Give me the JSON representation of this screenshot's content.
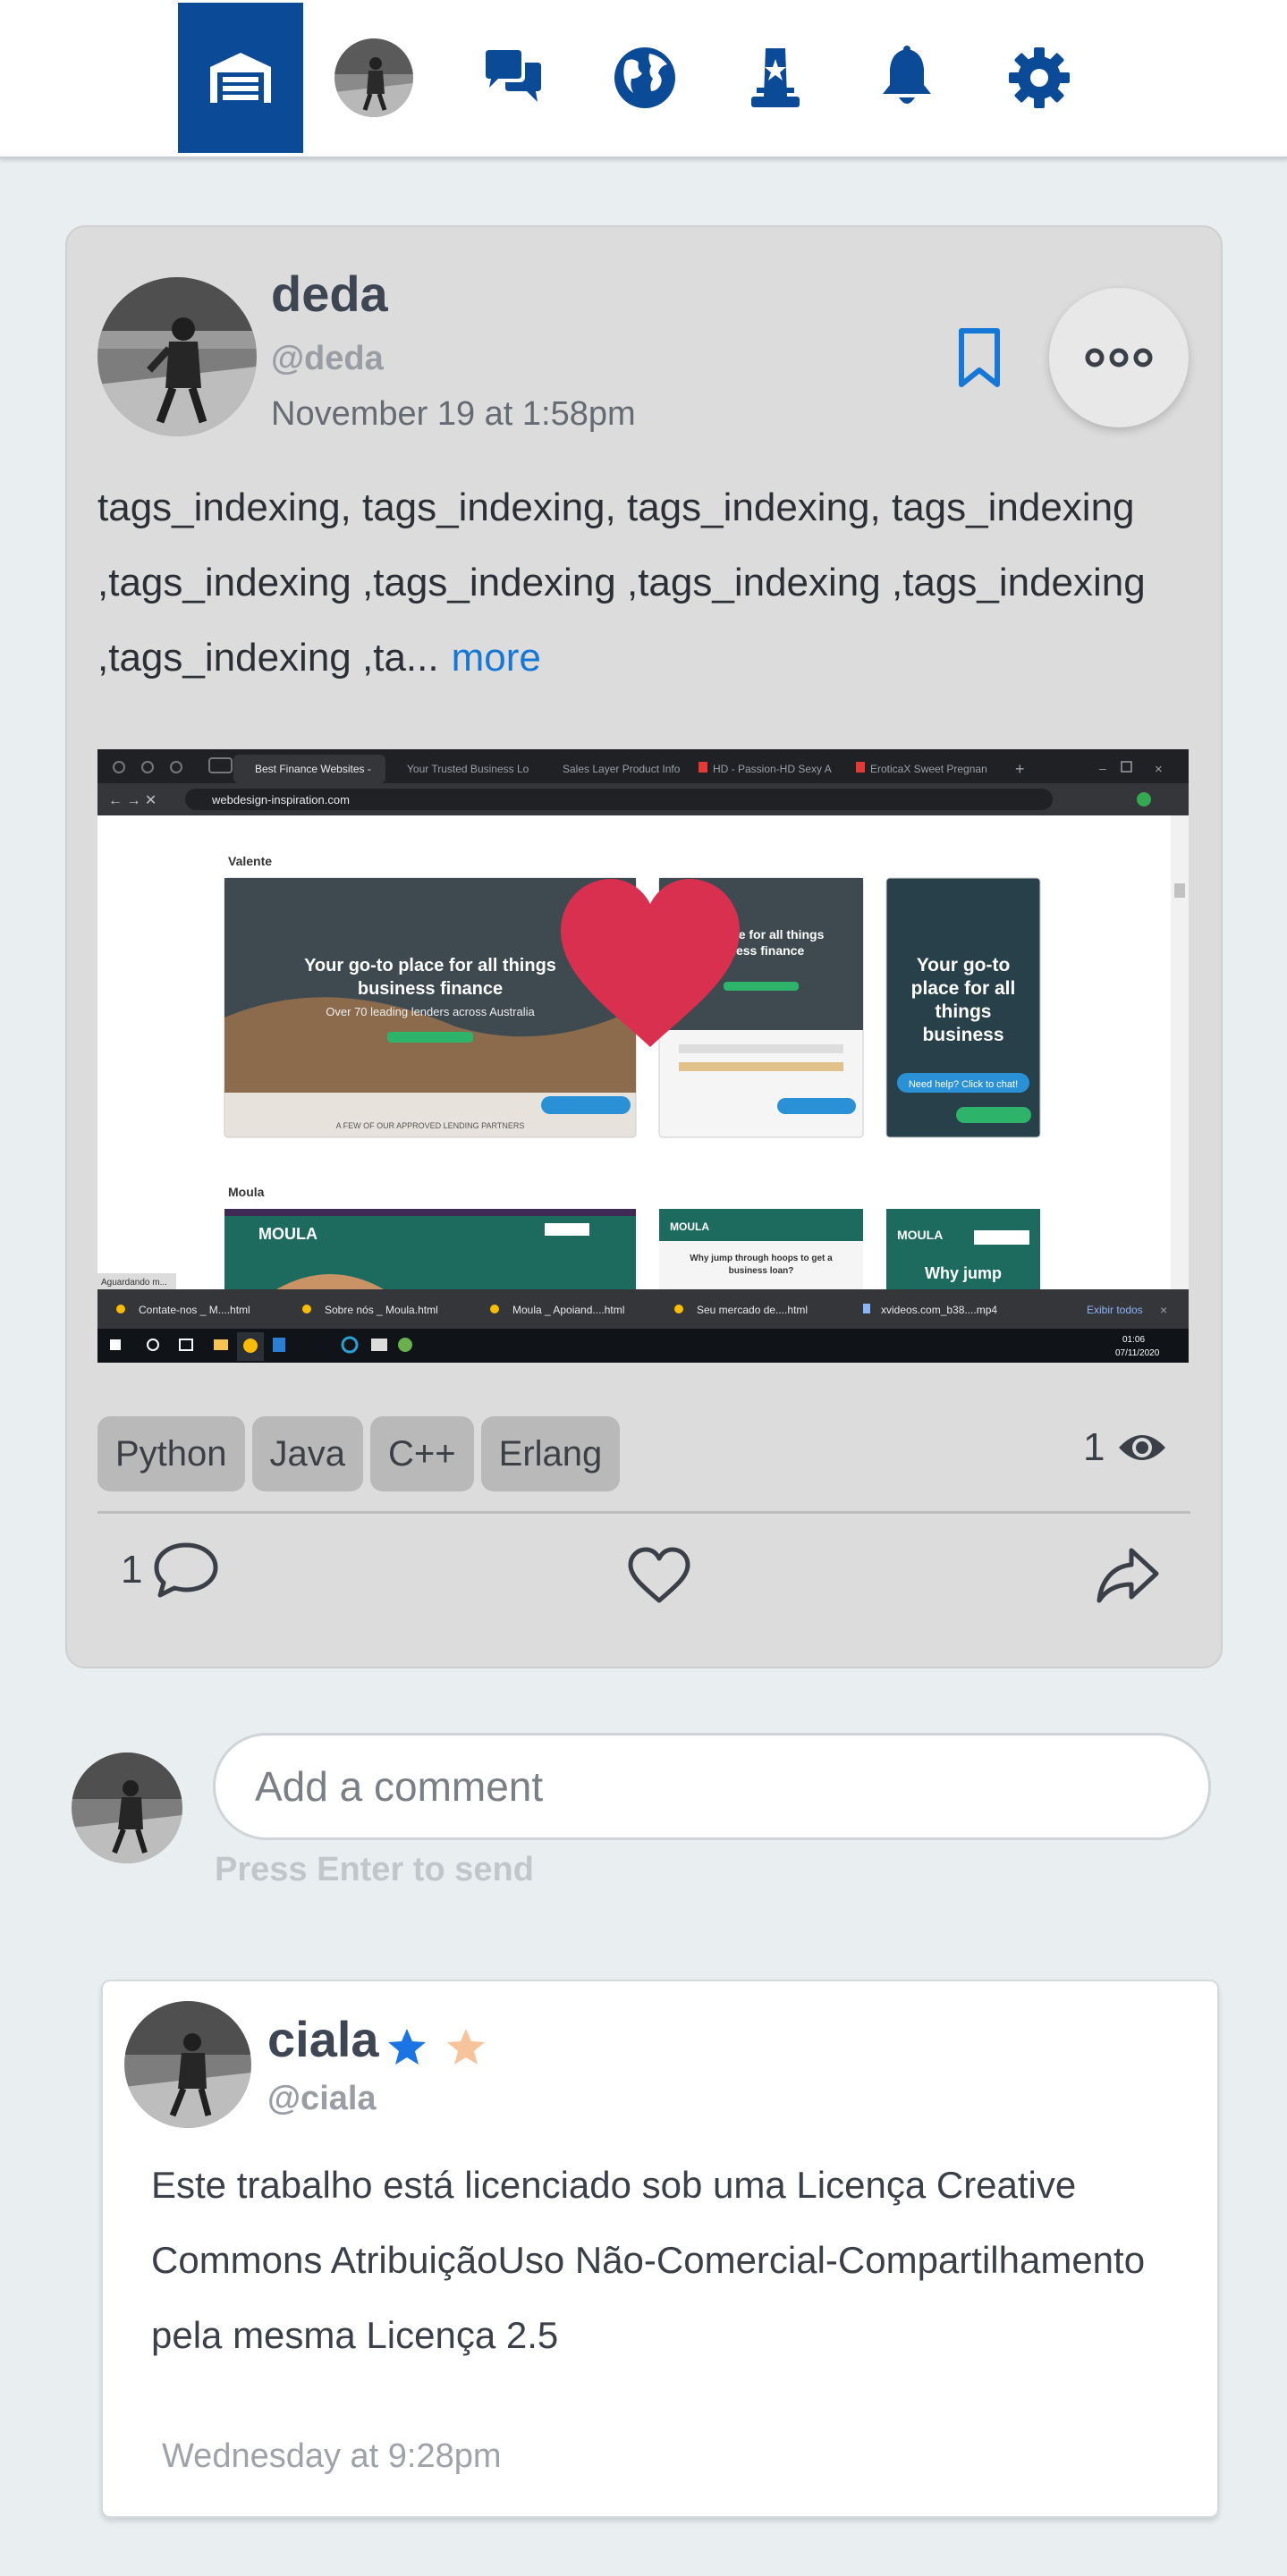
{
  "post": {
    "author_name": "deda",
    "author_handle": "@deda",
    "date": "November 19 at 1:58pm",
    "text": "tags_indexing, tags_indexing, tags_indexing, tags_indexing ,tags_indexing ,tags_indexing ,tags_indexing ,tags_indexing ,tags_indexing ,ta...",
    "more_label": "more",
    "tags": [
      "Python",
      "Java",
      "C++",
      "Erlang"
    ],
    "view_count": "1",
    "comment_count": "1"
  },
  "screenshot": {
    "tabs": [
      "Best Finance Websites -",
      "Your Trusted Business Lo",
      "Sales Layer Product Info",
      "HD - Passion-HD Sexy A",
      "EroticaX Sweet Pregnan"
    ],
    "url": "webdesign-inspiration.com",
    "section1": "Valente",
    "section2": "Moula",
    "card_headline": "Your go-to place for all things business finance",
    "card_sub": "Over 70 leading lenders across Australia",
    "card_partners": "A FEW OF OUR APPROVED LENDING PARTNERS",
    "card2_headline": "to place for all things siness finance",
    "card3_headline": "Your go-to place for all things business finance",
    "moula_headline": "Why jump through hoops to get a business loan?",
    "moula_short": "Why jump",
    "help_chat": "Need help? Click to chat!",
    "status": "Aguardando m...",
    "downloads": [
      "Contate-nos _ M....html",
      "Sobre nós _ Moula.html",
      "Moula _ Apoiand....html",
      "Seu mercado de....html",
      "xvideos.com_b38....mp4"
    ],
    "show_all": "Exibir todos",
    "clock_time": "01:06",
    "clock_date": "07/11/2020"
  },
  "comment_box": {
    "placeholder": "Add a comment",
    "hint": "Press Enter to send"
  },
  "comment": {
    "author_name": "ciala",
    "author_handle": "@ciala",
    "text": "Este trabalho está licenciado sob uma Licença Creative Commons AtribuiçãoUso Não-Comercial-Compartilhamento pela mesma Licença 2.5",
    "time": "Wednesday at 9:28pm"
  },
  "icons": {
    "nav": [
      "garage-icon",
      "avatar",
      "chat-bubbles-icon",
      "globe-icon",
      "tower-star-icon",
      "bell-icon",
      "gear-icon"
    ],
    "post": [
      "bookmark-icon",
      "more-dots-icon",
      "eye-icon",
      "comment-icon",
      "heart-icon",
      "share-icon"
    ]
  },
  "colors": {
    "brand": "#0a4a97",
    "link": "#1577d6",
    "heart": "#d9304f",
    "star_blue": "#1b74e4",
    "star_peach": "#f6c39a"
  }
}
